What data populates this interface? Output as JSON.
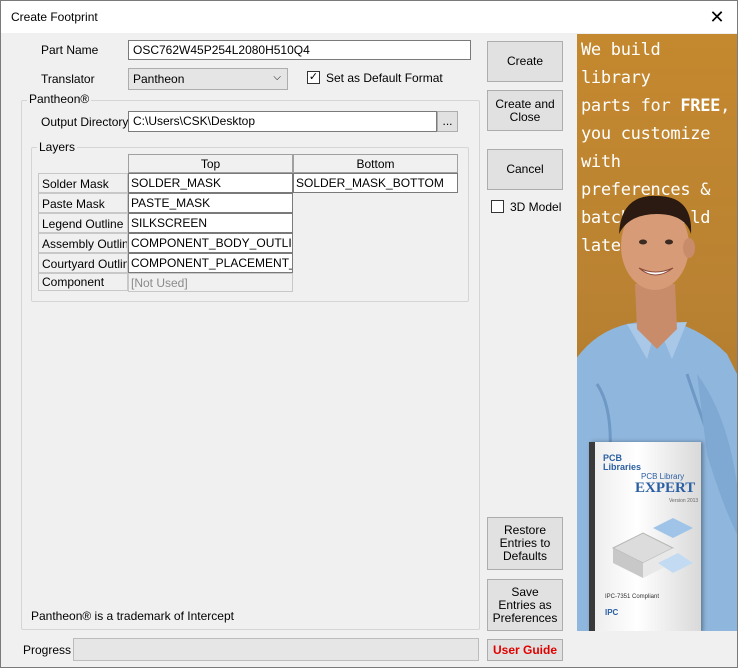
{
  "window": {
    "title": "Create Footprint",
    "close_glyph": "✕"
  },
  "form": {
    "part_name_label": "Part Name",
    "part_name_value": "OSC762W45P254L2080H510Q4",
    "translator_label": "Translator",
    "translator_value": "Pantheon",
    "default_format_label": "Set as Default Format",
    "default_format_checked": "✓"
  },
  "pantheon_group": {
    "title": "Pantheon®",
    "output_dir_label": "Output Directory",
    "output_dir_value": "C:\\Users\\CSK\\Desktop",
    "browse_label": "...",
    "trademark_text": "Pantheon® is a trademark of Intercept"
  },
  "layers": {
    "title": "Layers",
    "columns": [
      "Top",
      "Bottom"
    ],
    "rows": [
      {
        "name": "Solder Mask",
        "top": "SOLDER_MASK",
        "bottom": "SOLDER_MASK_BOTTOM"
      },
      {
        "name": "Paste Mask",
        "top": "PASTE_MASK"
      },
      {
        "name": "Legend Outline",
        "top": "SILKSCREEN"
      },
      {
        "name": "Assembly Outline",
        "top": "COMPONENT_BODY_OUTLINE"
      },
      {
        "name": "Courtyard Outline",
        "top": "COMPONENT_PLACEMENT_OU"
      },
      {
        "name": "Component",
        "top": "[Not Used]"
      }
    ]
  },
  "buttons": {
    "create": "Create",
    "create_close": "Create and Close",
    "cancel": "Cancel",
    "model_3d": "3D Model",
    "restore": "Restore Entries to Defaults",
    "save": "Save Entries as Preferences",
    "user_guide": "User Guide"
  },
  "status": {
    "progress_label": "Progress",
    "progress": 0
  },
  "ad": {
    "line1": "We build library",
    "line2_pre": "parts for ",
    "line2_bold": "FREE",
    "line2_post": ",",
    "line3": "you customize",
    "line4": "with preferences &",
    "line5": "batch-rebuild later!",
    "box_brand_1": "PCB",
    "box_brand_2": "Libraries",
    "box_subtitle": "PCB Library",
    "box_title": "EXPERT",
    "box_version": "Version 2013",
    "box_standard": "IPC-7351 Compliant",
    "box_logo": "IPC"
  }
}
